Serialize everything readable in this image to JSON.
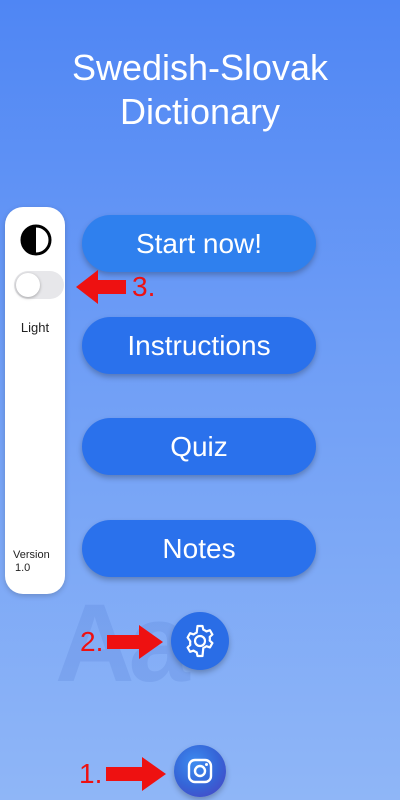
{
  "app": {
    "title_line1": "Swedish-Slovak",
    "title_line2": "Dictionary",
    "watermark": "Aa"
  },
  "sidebar": {
    "contrast_icon": "contrast-icon",
    "theme_toggle_state": "off",
    "theme_label": "Light",
    "version_line1": "Version",
    "version_line2": "1.0"
  },
  "menu": {
    "start_label": "Start now!",
    "instructions_label": "Instructions",
    "quiz_label": "Quiz",
    "notes_label": "Notes"
  },
  "icons": {
    "settings": "gear-icon",
    "instagram": "instagram-icon"
  },
  "annotations": {
    "one": "1.",
    "two": "2.",
    "three": "3."
  },
  "colors": {
    "background_top": "#4f86f4",
    "background_bottom": "#8fb6f7",
    "button": "#2a71ec",
    "annotation": "#ee1111"
  }
}
